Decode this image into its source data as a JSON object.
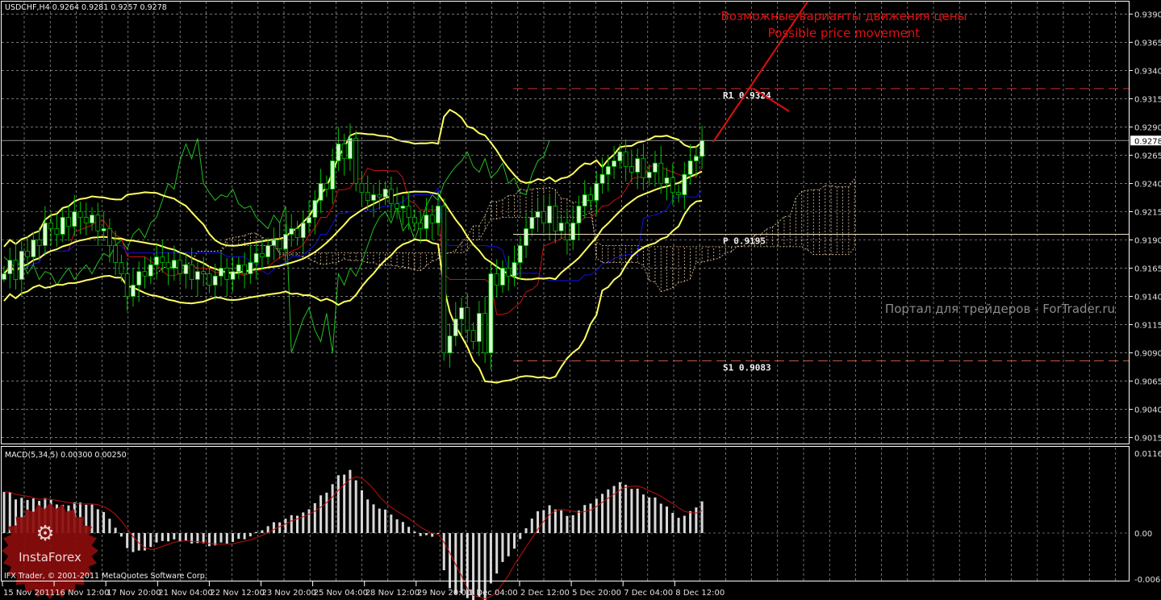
{
  "chart_data": {
    "type": "candlestick",
    "title": "USDCHF,H4",
    "header": "USDCHF,H4  0.9264 0.9281 0.9257 0.9278",
    "ylim": [
      0.9009,
      0.9401
    ],
    "price_ticks": [
      "0.9390",
      "0.9365",
      "0.9340",
      "0.9315",
      "0.9290",
      "0.9265",
      "0.9240",
      "0.9215",
      "0.9190",
      "0.9165",
      "0.9140",
      "0.9115",
      "0.9090",
      "0.9065",
      "0.9040",
      "0.9015"
    ],
    "current_price": "0.9278",
    "time_labels": [
      "15 Nov 2011",
      "16 Nov 12:00",
      "17 Nov 20:00",
      "21 Nov 04:00",
      "22 Nov 12:00",
      "23 Nov 20:00",
      "25 Nov 04:00",
      "28 Nov 12:00",
      "29 Nov 20:00",
      "1 Dec 04:00",
      "2 Dec 12:00",
      "5 Dec 20:00",
      "7 Dec 04:00",
      "8 Dec 12:00"
    ],
    "closes": [
      0.916,
      0.9172,
      0.9155,
      0.918,
      0.9175,
      0.919,
      0.9185,
      0.9205,
      0.92,
      0.9195,
      0.921,
      0.9202,
      0.9215,
      0.921,
      0.9205,
      0.9212,
      0.9198,
      0.92,
      0.9185,
      0.917,
      0.916,
      0.914,
      0.915,
      0.9162,
      0.9158,
      0.9168,
      0.9175,
      0.917,
      0.9165,
      0.9172,
      0.916,
      0.9168,
      0.9155,
      0.9162,
      0.916,
      0.915,
      0.9158,
      0.9165,
      0.9155,
      0.9162,
      0.9168,
      0.916,
      0.917,
      0.9178,
      0.9175,
      0.9185,
      0.919,
      0.9182,
      0.9195,
      0.92,
      0.9192,
      0.9205,
      0.921,
      0.9225,
      0.924,
      0.9235,
      0.926,
      0.9275,
      0.9262,
      0.928,
      0.924,
      0.9232,
      0.9225,
      0.923,
      0.9228,
      0.9235,
      0.9222,
      0.9218,
      0.922,
      0.921,
      0.9205,
      0.92,
      0.9212,
      0.9205,
      0.922,
      0.909,
      0.9105,
      0.912,
      0.913,
      0.911,
      0.91,
      0.9125,
      0.909,
      0.916,
      0.915,
      0.9165,
      0.9158,
      0.917,
      0.9185,
      0.92,
      0.921,
      0.9215,
      0.9205,
      0.922,
      0.9198,
      0.9205,
      0.919,
      0.9205,
      0.922,
      0.923,
      0.9225,
      0.924,
      0.9248,
      0.9255,
      0.926,
      0.9268,
      0.9255,
      0.925,
      0.9262,
      0.9245,
      0.925,
      0.9258,
      0.924,
      0.9245,
      0.9232,
      0.923,
      0.9248,
      0.926,
      0.9264,
      0.9278
    ],
    "levels": [
      {
        "name": "r1",
        "label": "R1  0.9324",
        "value": 0.9324,
        "color": "#c83030",
        "style": "dashed"
      },
      {
        "name": "pivot",
        "label": "P  0.9195",
        "value": 0.9195,
        "color": "#f0e0c0",
        "style": "solid"
      },
      {
        "name": "s1",
        "label": "S1  0.9083",
        "value": 0.9083,
        "color": "#c86040",
        "style": "dashed"
      }
    ],
    "indicators": {
      "bollinger": {
        "period": 20,
        "deviation": 2,
        "color": "#ffff60"
      },
      "ichimoku": {
        "tenkan": 9,
        "kijun": 26,
        "senkou": 52,
        "tenkan_color": "#cc1010",
        "kijun_color": "#1010dd",
        "chikou_color": "#20c020",
        "cloud_color": "#e8c8a0"
      }
    },
    "macd": {
      "label": "MACD(5,34,5) 0.00300 0.00250",
      "fast": 5,
      "slow": 34,
      "signal": 5,
      "ylim": [
        -0.00684,
        0.01163
      ],
      "ticks": [
        "0.01163",
        "0.00",
        "-0.00684"
      ]
    }
  },
  "annotations": {
    "ru_title": "Возможные варианты движения цены",
    "en_title": "Possible price movement",
    "watermark": "Портал для трейдеров - ForTrader.ru",
    "copyright_prefix": "IFX Trader, © 2001-2011 MetaQuotes Software Corp.",
    "logo": "InstaForex"
  },
  "colors": {
    "background": "#000000",
    "grid": "#c8c8c8",
    "bull": "#d8ffd0",
    "wick": "#00c000",
    "annotation": "#e01010"
  }
}
